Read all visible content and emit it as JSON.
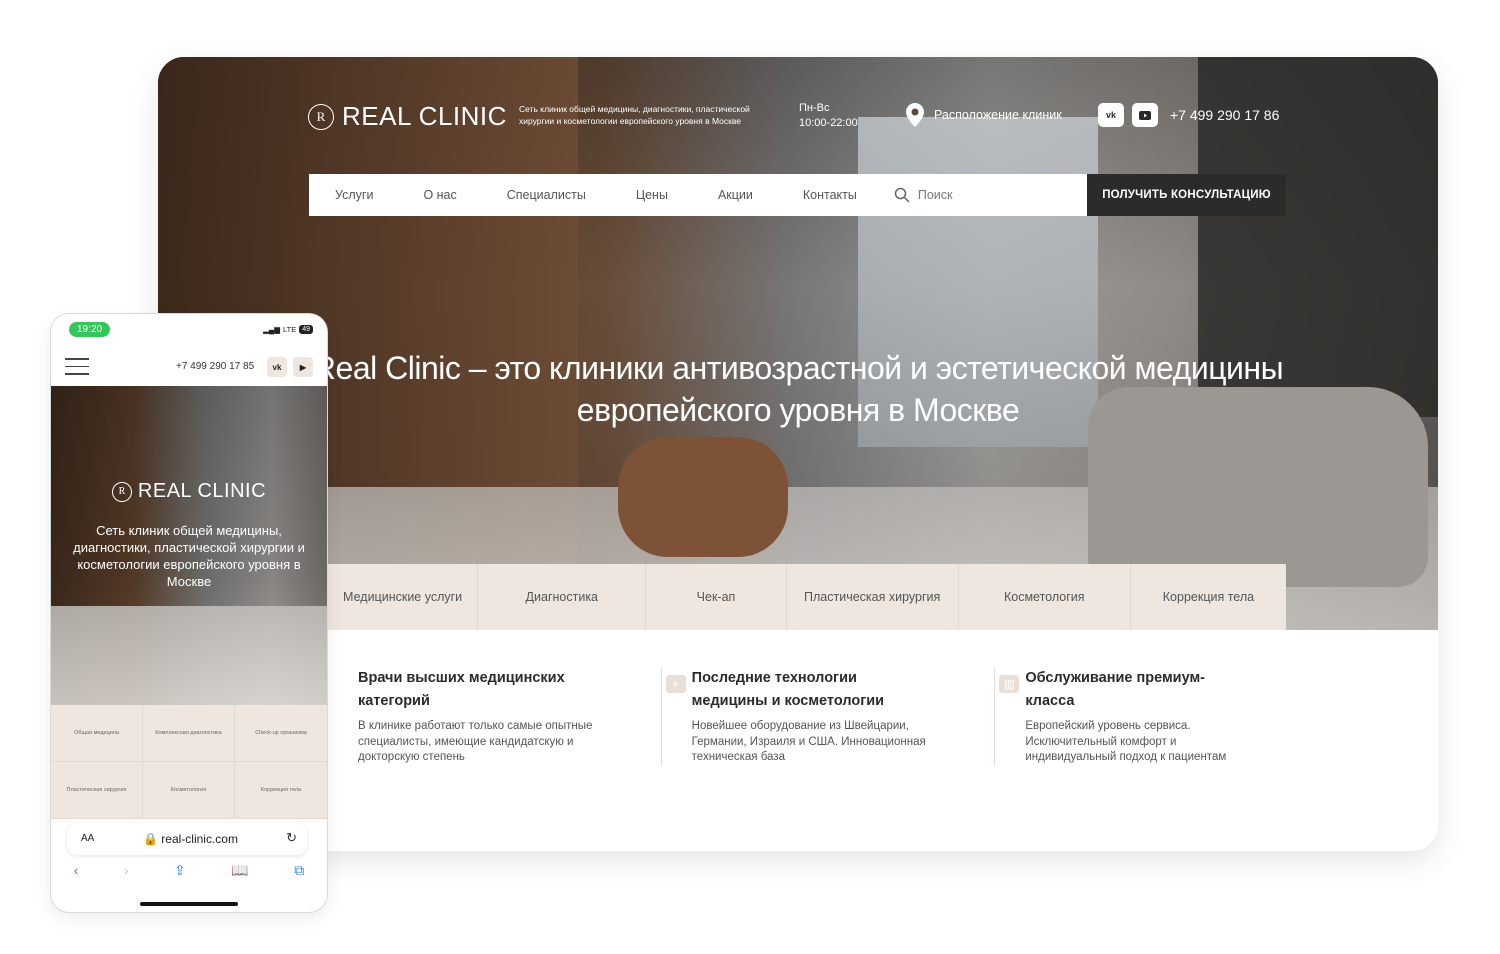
{
  "desktop": {
    "brand": "REAL CLINIC",
    "tagline": "Сеть клиник общей медицины, диагностики, пластической хирургии и косметологии европейского уровня в Москве",
    "hours_days": "Пн-Вс",
    "hours_time": "10:00-22:00",
    "location_label": "Расположение клиник",
    "social": [
      "vk",
      "youtube"
    ],
    "phone": "+7 499 290 17 86",
    "nav": [
      "Услуги",
      "О нас",
      "Специалисты",
      "Цены",
      "Акции",
      "Контакты"
    ],
    "search_placeholder": "Поиск",
    "cta": "ПОЛУЧИТЬ КОНСУЛЬТАЦИЮ",
    "headline": "Real Clinic – это клиники антивозрастной и эстетической медицины европейского уровня в Москве",
    "categories": [
      "Медицинские услуги",
      "Диагностика",
      "Чек-ап",
      "Пластическая хирургия",
      "Косметология",
      "Коррекция тела"
    ],
    "features": [
      {
        "title": "Врачи высших медицинских категорий",
        "text": "В клинике работают только самые опытные специалисты, имеющие кандидатскую и докторскую степень"
      },
      {
        "title": "Последние технологии медицины и косметологии",
        "text": "Новейшее оборудование из Швейцарии, Германии, Израиля и США. Инновационная техническая база"
      },
      {
        "title": "Обслуживание премиум-класса",
        "text": "Европейский уровень сервиса. Исключительный комфорт и индивидуальный подход к пациентам"
      }
    ]
  },
  "mobile": {
    "time": "19:20",
    "network": "LTE",
    "battery": "49",
    "phone": "+7 499 290 17 85",
    "brand": "REAL CLINIC",
    "tagline": "Сеть клиник общей медицины, диагностики, пластической хирургии и косметологии европейского уровня в Москве",
    "grid": [
      "Общая медицина",
      "Комплексная диагностика",
      "Check-up организма",
      "Пластическая хирургия",
      "Косметология",
      "Коррекция тела"
    ],
    "aa_label": "AA",
    "url": "real-clinic.com"
  },
  "colors": {
    "beige": "#efe6df",
    "dark": "#2b2b2b",
    "ios_green": "#34c759",
    "ios_blue": "#2f7cf6"
  }
}
